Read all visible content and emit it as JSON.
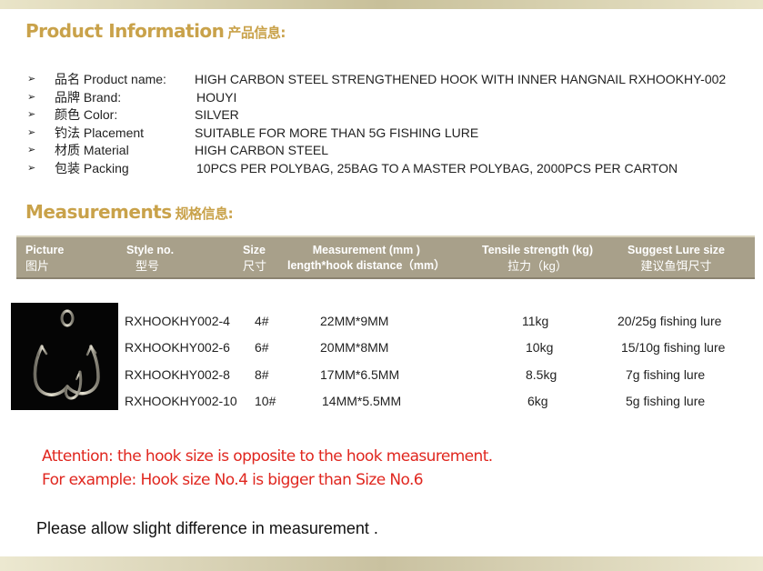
{
  "product_section": {
    "title_en": "Product Information",
    "title_cn": "产品信息:"
  },
  "info_rows": [
    {
      "label": "品名 Product name:",
      "value": "HIGH CARBON STEEL STRENGTHENED HOOK WITH INNER HANGNAIL RXHOOKHY-002"
    },
    {
      "label": "品牌 Brand:",
      "value": "HOUYI"
    },
    {
      "label": "颜色 Color:",
      "value": "SILVER"
    },
    {
      "label": "钓法 Placement",
      "value": "SUITABLE FOR MORE THAN 5G FISHING LURE"
    },
    {
      "label": "材质 Material",
      "value": "HIGH CARBON STEEL"
    },
    {
      "label": "包装 Packing",
      "value": "10PCS PER POLYBAG, 25BAG TO A MASTER POLYBAG, 2000PCS PER CARTON"
    }
  ],
  "bullet_glyph": "➢",
  "measurements_section": {
    "title_en": "Measurements",
    "title_cn": "规格信息:"
  },
  "table": {
    "headers": [
      {
        "en": "Picture",
        "zh": "图片"
      },
      {
        "en": "Style no.",
        "zh": "型号"
      },
      {
        "en": "Size",
        "zh": "尺寸"
      },
      {
        "en": "Measurement (mm )",
        "zh": "length*hook distance（mm）"
      },
      {
        "en": "Tensile strength (kg)",
        "zh": "拉力（kg）"
      },
      {
        "en": "Suggest Lure size",
        "zh": "建议鱼饵尺寸"
      }
    ],
    "rows": [
      {
        "style": "RXHOOKHY002-4",
        "size": "4#",
        "measurement": "22MM*9MM",
        "tensile": "11kg",
        "lure": "20/25g fishing lure"
      },
      {
        "style": "RXHOOKHY002-6",
        "size": "6#",
        "measurement": "20MM*8MM",
        "tensile": "10kg",
        "lure": "15/10g fishing lure"
      },
      {
        "style": "RXHOOKHY002-8",
        "size": "8#",
        "measurement": "17MM*6.5MM",
        "tensile": "8.5kg",
        "lure": "7g fishing lure"
      },
      {
        "style": "RXHOOKHY002-10",
        "size": "10#",
        "measurement": "14MM*5.5MM",
        "tensile": "6kg",
        "lure": "5g fishing lure"
      }
    ]
  },
  "attention": {
    "line1": "Attention: the hook size is opposite to the hook measurement.",
    "line2": "For example: Hook size No.4 is bigger than Size No.6"
  },
  "note": "Please allow slight difference in measurement .",
  "colors": {
    "title_gold": "#c9a24a",
    "header_bg": "#a8a08a",
    "attention_red": "#e0271f"
  }
}
